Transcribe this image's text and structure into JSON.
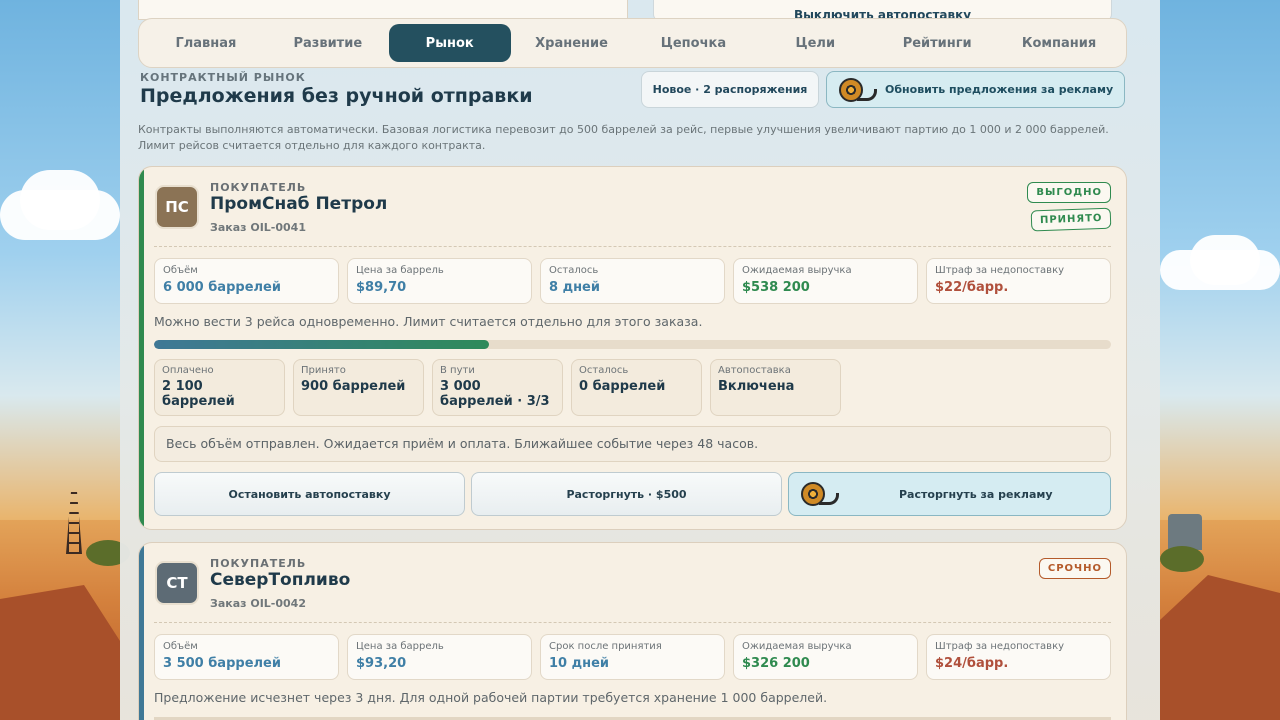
{
  "top_strip": {
    "autoship_label": "Выключить автопоставку"
  },
  "nav": {
    "tabs": [
      "Главная",
      "Развитие",
      "Рынок",
      "Хранение",
      "Цепочка",
      "Цели",
      "Рейтинги",
      "Компания"
    ],
    "active": "Рынок"
  },
  "header": {
    "eyebrow": "КОНТРАКТНЫЙ РЫНОК",
    "title": "Предложения без ручной отправки",
    "orders_label": "Новое · 2 распоряжения",
    "refresh_label": "Обновить предложения за рекламу"
  },
  "note": "Контракты выполняются автоматически. Базовая логистика перевозит до 500 баррелей за рейс, первые улучшения увеличивают партию до 1 000 и 2 000 баррелей. Лимит рейсов считается отдельно для каждого контракта.",
  "contracts": [
    {
      "role": "ПОКУПАТЕЛЬ",
      "initials": "ПС",
      "company": "ПромСнаб Петрол",
      "order": "Заказ OIL-0041",
      "badges": [
        "ВЫГОДНО",
        "ПРИНЯТО"
      ],
      "stats": [
        {
          "label": "Объём",
          "value": "6 000 баррелей"
        },
        {
          "label": "Цена за баррель",
          "value": "$89,70"
        },
        {
          "label": "Осталось",
          "value": "8 дней"
        },
        {
          "label": "Ожидаемая выручка",
          "value": "$538 200"
        },
        {
          "label": "Штраф за недопоставку",
          "value": "$22/барр."
        }
      ],
      "trips_text": "Можно вести 3 рейса одновременно. Лимит считается отдельно для этого заказа.",
      "progress": 0.35,
      "progress_stats": [
        {
          "label": "Оплачено",
          "value": "2 100 баррелей"
        },
        {
          "label": "Принято",
          "value": "900 баррелей"
        },
        {
          "label": "В пути",
          "value": "3 000 баррелей · 3/3"
        },
        {
          "label": "Осталось",
          "value": "0 баррелей"
        },
        {
          "label": "Автопоставка",
          "value": "Включена"
        }
      ],
      "status_text": "Весь объём отправлен. Ожидается приём и оплата. Ближайшее событие через 48 часов.",
      "actions": [
        "Остановить автопоставку",
        "Расторгнуть · $500",
        "Расторгнуть за рекламу"
      ]
    },
    {
      "role": "ПОКУПАТЕЛЬ",
      "initials": "СТ",
      "company": "СеверТопливо",
      "order": "Заказ OIL-0042",
      "badges": [
        "СРОЧНО"
      ],
      "stats": [
        {
          "label": "Объём",
          "value": "3 500 баррелей"
        },
        {
          "label": "Цена за баррель",
          "value": "$93,20"
        },
        {
          "label": "Срок после принятия",
          "value": "10 дней"
        },
        {
          "label": "Ожидаемая выручка",
          "value": "$326 200"
        },
        {
          "label": "Штраф за недопоставку",
          "value": "$24/барр."
        }
      ],
      "info_text": "Предложение исчезнет через 3 дня. Для одной рабочей партии требуется хранение 1 000 баррелей."
    }
  ],
  "colors": {
    "accent_dark": "#24505f",
    "profit_green": "#2f8a4f",
    "penalty_red": "#b0503c",
    "urgent_orange": "#b45a2a"
  },
  "icons": {
    "ad_reel": "film-reel-icon"
  }
}
